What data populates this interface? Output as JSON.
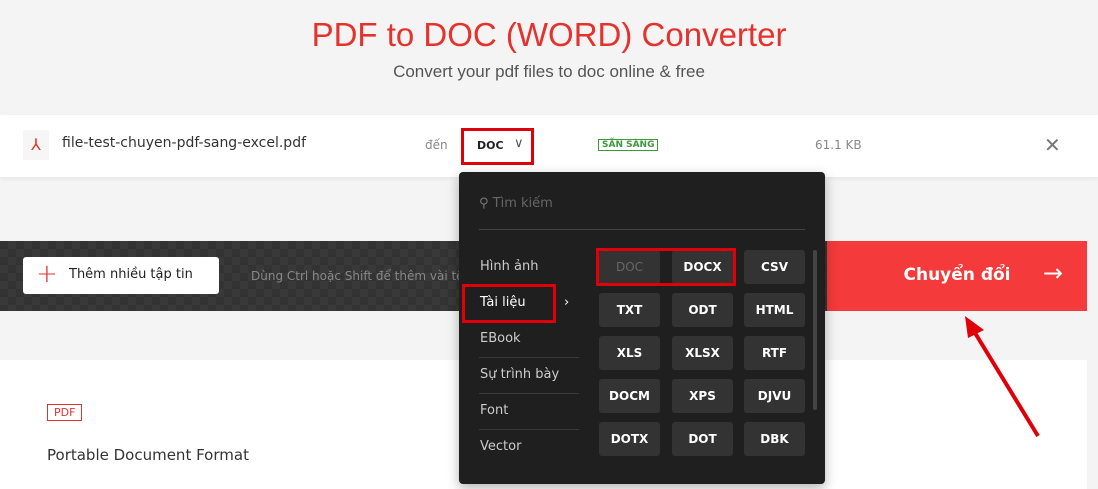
{
  "header": {
    "title": "PDF to DOC (WORD) Converter",
    "subtitle": "Convert your pdf files to doc online & free"
  },
  "file": {
    "name": "file-test-chuyen-pdf-sang-excel.pdf",
    "to_label": "đến",
    "format": "DOC",
    "status": "SẴN SÀNG",
    "size": "61.1 KB"
  },
  "toolbar": {
    "add_label": "Thêm nhiều tập tin",
    "hint": "Dùng Ctrl hoặc Shift để thêm vài tệp",
    "convert_label": "Chuyển đổi"
  },
  "dropdown": {
    "search_placeholder": "Tìm kiếm",
    "categories": [
      "Hình ảnh",
      "Tài liệu",
      "EBook",
      "Sự trình bày",
      "Font",
      "Vector"
    ],
    "selected_category": "Tài liệu",
    "formats": [
      "DOC",
      "DOCX",
      "CSV",
      "TXT",
      "ODT",
      "HTML",
      "XLS",
      "XLSX",
      "RTF",
      "DOCM",
      "XPS",
      "DJVU",
      "DOTX",
      "DOT",
      "DBK"
    ]
  },
  "info": {
    "badge": "PDF",
    "description": "Portable Document Format"
  },
  "colors": {
    "accent": "#e5322d",
    "annotation": "#e0000a"
  }
}
